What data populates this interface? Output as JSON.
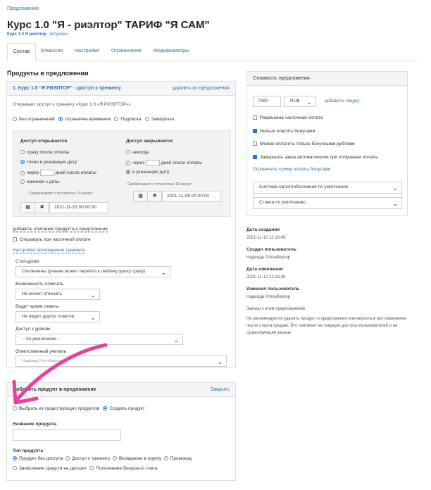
{
  "breadcrumb": "Предложения",
  "title": "Курс 1.0 \"Я - риэлтор\" ТАРИФ \"Я САМ\"",
  "tag_code": "Курс 1.0 Я риэлтор",
  "status": "Актуален",
  "tabs": [
    "Состав",
    "Комиссия",
    "Настройки",
    "Ограничения",
    "Модификаторы"
  ],
  "products_title": "Продукты в предложении",
  "product": {
    "header": "1. Курс 1.0 \"Я РИЭЛТОР\" - доступ к тренингу",
    "delete_link": "удалить из предложения",
    "desc": "Открывает доступ к тренингу «Курс 1.0 «Я РИЭЛТОР»»",
    "modes": [
      "Без ограничений",
      "Ограничен временем",
      "Подписка",
      "Заморозка"
    ],
    "open_title": "Доступ открывается",
    "open_options": [
      "сразу после оплаты",
      "точно в указанную дату",
      "через",
      "дней после оплаты",
      "начиная с даты"
    ],
    "open_note": "Срабатывает с точностью 15 минут",
    "open_date": "2021-11-15 00:00:00",
    "close_title": "Доступ закрывается",
    "close_options": [
      "никогда",
      "через",
      "дней после оплаты",
      "в указанную дату"
    ],
    "close_note": "Срабатывает с точностью 15 минут",
    "close_date": "2021-11-08 00:00:00",
    "add_desc_link": "добавить описание продукта в предложении",
    "partial_open": "Открывать при частичной оплате",
    "settings_link": "Настройки прохождения тренинга",
    "stop_lessons_label": "Стоп-уроки",
    "stop_lessons_value": "Отключены (ученик может перейти к любому уроку сразу)",
    "can_answer_label": "Возможность отвечать",
    "can_answer_value": "Не может отвечать",
    "sees_answers_label": "Видит чужие ответы",
    "sees_answers_value": "Не видит других ответов",
    "lessons_access_label": "Доступ к урокам",
    "lessons_access_value": "-- по умолчанию --",
    "teacher_label": "Ответственный учитель",
    "teacher_value": "Надежда Ротенбергер"
  },
  "add_product": {
    "title": "Добавить продукт в предложение",
    "close_link": "Закрыть",
    "choices": [
      "Выбрать из существующих продуктов",
      "Создать продукт"
    ],
    "name_label": "Название продукта",
    "type_label": "Тип продукта",
    "types_row1": [
      "Продукт без доступа",
      "Доступ к тренингу",
      "Вхождение в группу",
      "Промокод"
    ],
    "types_row2": [
      "Зачисление средств на депозит",
      "Пополнение бонусного счета"
    ]
  },
  "price": {
    "title": "Стоимость предложения",
    "amount": "7990",
    "currency": "RUB",
    "discount_link": "добавить скидку",
    "options": [
      {
        "label": "Разрешена частичная оплата",
        "checked": false
      },
      {
        "label": "Нельзя платить бонусами",
        "checked": true
      },
      {
        "label": "Можно оплатить только бонусными рублями",
        "checked": false
      },
      {
        "label": "Завершать заказ автоматически при получении оплаты",
        "checked": true
      }
    ],
    "bonus_link": "Ограничить сумму оплаты бонусами",
    "tax_system": "Система налогообложения по умолчанию",
    "tax_rate": "Ставка по умолчанию"
  },
  "meta": {
    "created_label": "Дата создания",
    "created_value": "2021-11-12 12:18:49",
    "creator_label": "Создал пользователь",
    "creator_value": "Надежда Ротенбергер",
    "modified_label": "Дата изменения",
    "modified_value": "2021-11-12 12:18:49",
    "modifier_label": "Изменил пользователь",
    "modifier_value": "Надежда Ротенбергер",
    "orders_link": "Заказы с этим предложением",
    "warning": "Не рекомендуется удалять продукт и предложения или вносить в них изменения после старта продаж. Это повлияет на текущие доступы пользователей и на существующие заказы"
  },
  "colors": {
    "link": "#2f6fad",
    "arrow": "#e8409c",
    "accent": "#1a73e8"
  }
}
